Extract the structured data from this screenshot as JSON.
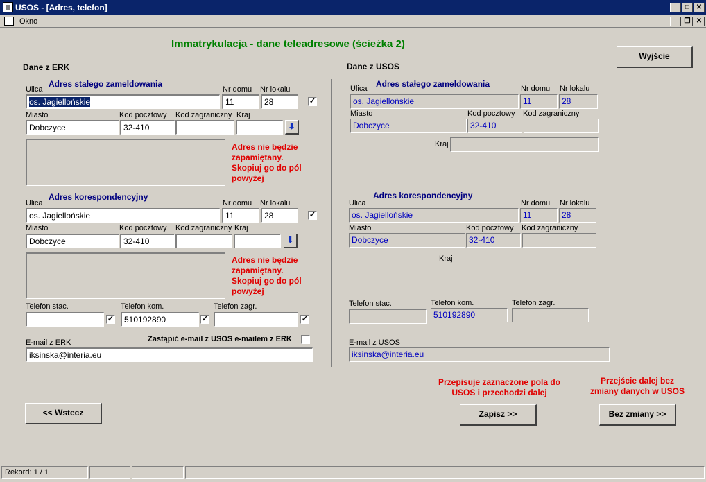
{
  "window": {
    "title": "USOS - [Adres, telefon]",
    "menu_okno": "Okno"
  },
  "page": {
    "title": "Immatrykulacja - dane teleadresowe (ścieżka 2)",
    "exit_button": "Wyjście"
  },
  "erk": {
    "header": "Dane z ERK",
    "permanent": {
      "section": "Adres stałego zameldowania",
      "ulica_label": "Ulica",
      "ulica": "os. Jagiellońskie",
      "nr_domu_label": "Nr domu",
      "nr_domu": "11",
      "nr_lokalu_label": "Nr lokalu",
      "nr_lokalu": "28",
      "checked": true,
      "miasto_label": "Miasto",
      "miasto": "Dobczyce",
      "kod_label": "Kod pocztowy",
      "kod": "32-410",
      "kod_zagr_label": "Kod zagraniczny",
      "kod_zagr": "",
      "kraj_label": "Kraj",
      "kraj": "",
      "warning": "Adres nie będzie zapamiętany. Skopiuj go do pól powyżej"
    },
    "corr": {
      "section": "Adres korespondencyjny",
      "ulica_label": "Ulica",
      "ulica": "os. Jagiellońskie",
      "nr_domu_label": "Nr domu",
      "nr_domu": "11",
      "nr_lokalu_label": "Nr lokalu",
      "nr_lokalu": "28",
      "checked": true,
      "miasto_label": "Miasto",
      "miasto": "Dobczyce",
      "kod_label": "Kod pocztowy",
      "kod": "32-410",
      "kod_zagr_label": "Kod zagraniczny",
      "kod_zagr": "",
      "kraj_label": "Kraj",
      "kraj": "",
      "warning": "Adres nie będzie zapamiętany. Skopiuj go do pól powyżej"
    },
    "phone": {
      "stac_label": "Telefon stac.",
      "stac": "",
      "stac_checked": true,
      "kom_label": "Telefon kom.",
      "kom": "510192890",
      "kom_checked": true,
      "zagr_label": "Telefon zagr.",
      "zagr": "",
      "zagr_checked": true
    },
    "email_label": "E-mail z ERK",
    "email": "iksinska@interia.eu",
    "replace_email_label": "Zastąpić e-mail z USOS e-mailem z ERK",
    "replace_email_checked": false
  },
  "usos": {
    "header": "Dane z USOS",
    "permanent": {
      "section": "Adres stałego zameldowania",
      "ulica_label": "Ulica",
      "ulica": "os. Jagiellońskie",
      "nr_domu_label": "Nr domu",
      "nr_domu": "11",
      "nr_lokalu_label": "Nr lokalu",
      "nr_lokalu": "28",
      "miasto_label": "Miasto",
      "miasto": "Dobczyce",
      "kod_label": "Kod pocztowy",
      "kod": "32-410",
      "kod_zagr_label": "Kod zagraniczny",
      "kod_zagr": "",
      "kraj_label": "Kraj",
      "kraj": ""
    },
    "corr": {
      "section": "Adres korespondencyjny",
      "ulica_label": "Ulica",
      "ulica": "os. Jagiellońskie",
      "nr_domu_label": "Nr domu",
      "nr_domu": "11",
      "nr_lokalu_label": "Nr lokalu",
      "nr_lokalu": "28",
      "miasto_label": "Miasto",
      "miasto": "Dobczyce",
      "kod_label": "Kod pocztowy",
      "kod": "32-410",
      "kod_zagr_label": "Kod zagraniczny",
      "kod_zagr": "",
      "kraj_label": "Kraj",
      "kraj": ""
    },
    "phone": {
      "stac_label": "Telefon stac.",
      "stac": "",
      "kom_label": "Telefon kom.",
      "kom": "510192890",
      "zagr_label": "Telefon zagr.",
      "zagr": ""
    },
    "email_label": "E-mail z USOS",
    "email": "iksinska@interia.eu"
  },
  "actions": {
    "back": "<< Wstecz",
    "save": "Zapisz >>",
    "save_note": "Przepisuje zaznaczone pola do USOS i przechodzi dalej",
    "nochange": "Bez zmiany >>",
    "nochange_note": "Przejście dalej bez zmiany danych w USOS"
  },
  "status": {
    "record": "Rekord: 1 / 1"
  },
  "icons": {
    "checkbox_mark": "✓",
    "download": "⬇",
    "minimize": "_",
    "maximize": "□",
    "restore": "❐",
    "close": "✕"
  },
  "colors": {
    "title_green": "#008000",
    "section_blue": "#000080",
    "warning_red": "#e00000",
    "titlebar": "#0a246a"
  }
}
